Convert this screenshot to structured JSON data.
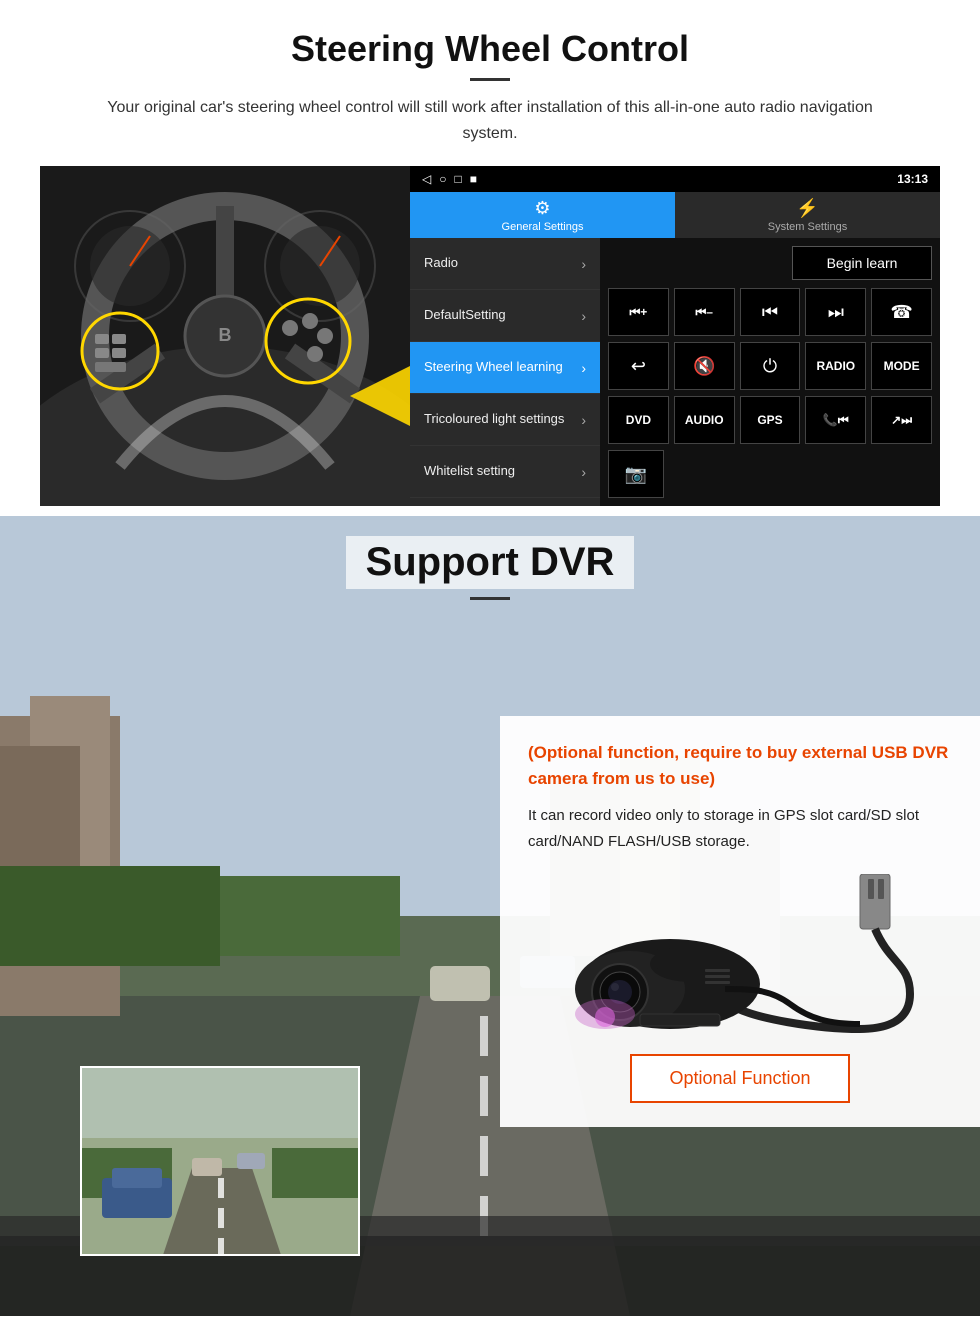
{
  "steering": {
    "title": "Steering Wheel Control",
    "description": "Your original car's steering wheel control will still work after installation of this all-in-one auto radio navigation system.",
    "statusbar": {
      "time": "13:13",
      "icons": [
        "◁",
        "○",
        "□",
        "■"
      ]
    },
    "tabs": {
      "general": "General Settings",
      "system": "System Settings"
    },
    "menu_items": [
      {
        "label": "Radio",
        "active": false
      },
      {
        "label": "DefaultSetting",
        "active": false
      },
      {
        "label": "Steering Wheel learning",
        "active": true
      },
      {
        "label": "Tricoloured light settings",
        "active": false
      },
      {
        "label": "Whitelist setting",
        "active": false
      }
    ],
    "begin_learn": "Begin learn",
    "buttons_row1": [
      "⏮+",
      "⏮–",
      "⏮",
      "⏭",
      "☎"
    ],
    "buttons_row2": [
      "↩",
      "🔇",
      "⏻",
      "RADIO",
      "MODE"
    ],
    "buttons_row3": [
      "DVD",
      "AUDIO",
      "GPS",
      "📞⏮",
      "↗⏭"
    ],
    "buttons_row4": [
      "📷"
    ]
  },
  "dvr": {
    "title": "Support DVR",
    "optional_text": "(Optional function, require to buy external USB DVR camera from us to use)",
    "description": "It can record video only to storage in GPS slot card/SD slot card/NAND FLASH/USB storage.",
    "optional_function_btn": "Optional Function"
  }
}
